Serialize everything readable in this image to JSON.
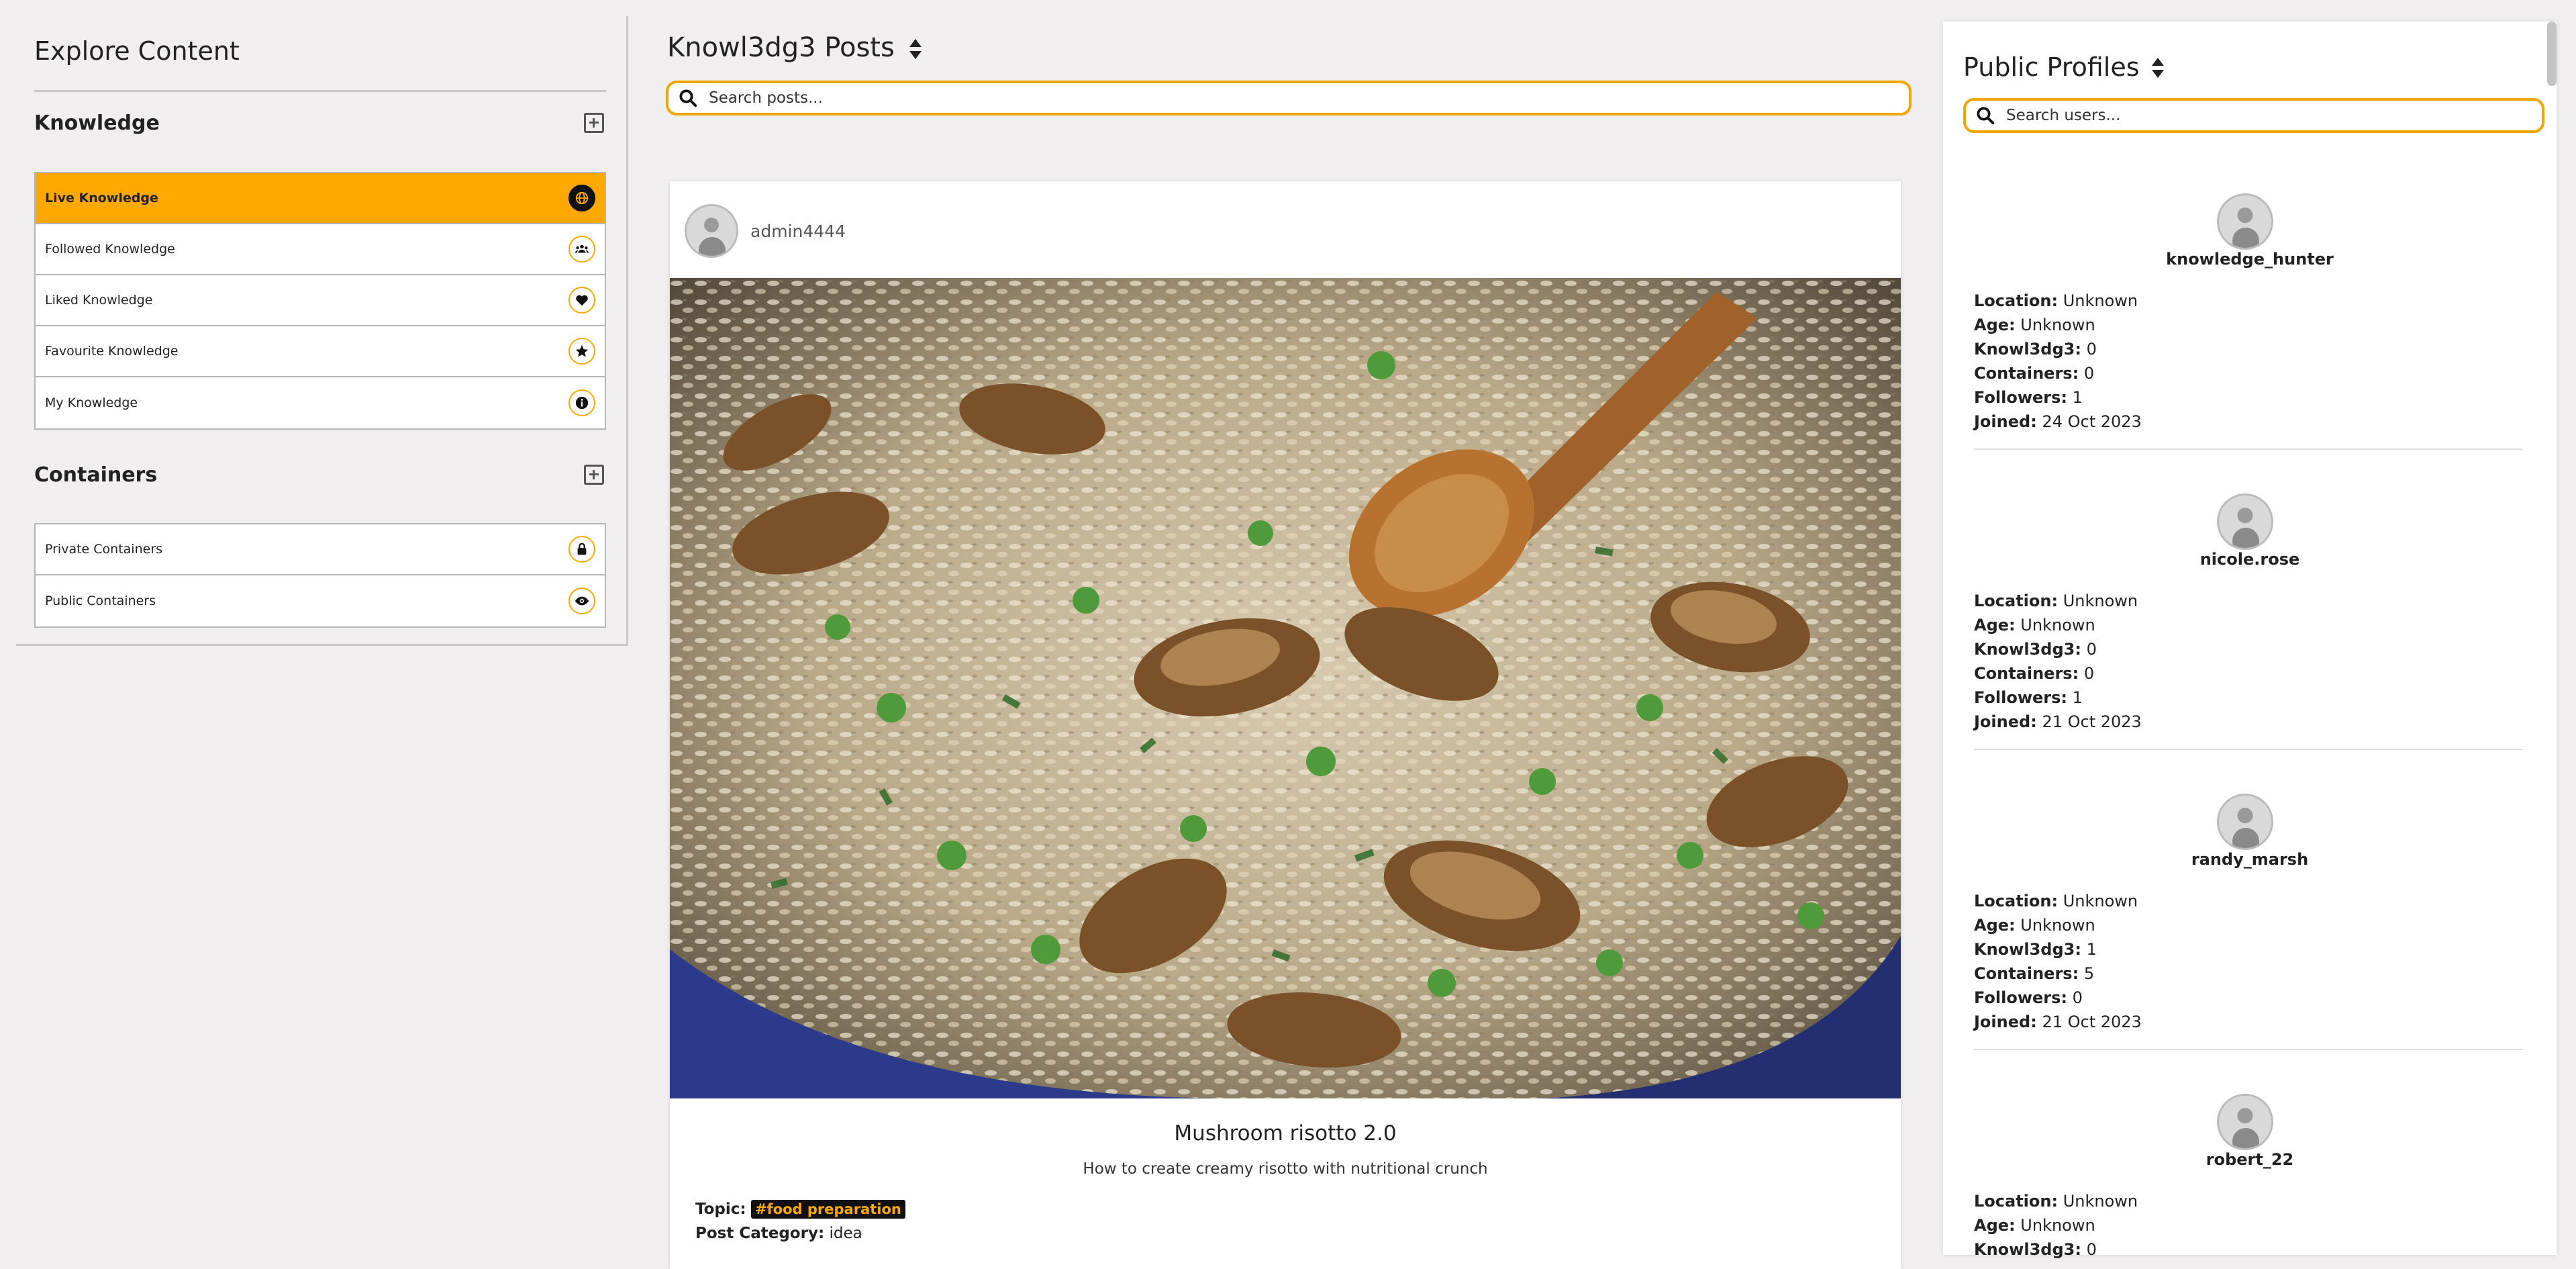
{
  "sidebar": {
    "title": "Explore Content",
    "knowledge_heading": "Knowledge",
    "knowledge_items": [
      {
        "label": "Live Knowledge",
        "icon": "globe-icon"
      },
      {
        "label": "Followed Knowledge",
        "icon": "users-icon"
      },
      {
        "label": "Liked Knowledge",
        "icon": "heart-icon"
      },
      {
        "label": "Favourite Knowledge",
        "icon": "star-icon"
      },
      {
        "label": "My Knowledge",
        "icon": "info-icon"
      }
    ],
    "containers_heading": "Containers",
    "container_items": [
      {
        "label": "Private Containers",
        "icon": "lock-icon"
      },
      {
        "label": "Public Containers",
        "icon": "eye-icon"
      }
    ],
    "accent_color": "#ffa800"
  },
  "posts": {
    "title": "Knowl3dg3 Posts",
    "search_placeholder": "Search posts...",
    "post": {
      "author": "admin4444",
      "title": "Mushroom risotto 2.0",
      "subtitle": "How to create creamy risotto with nutritional crunch",
      "topic_label": "Topic:",
      "topic": "#food preparation",
      "category_label": "Post Category:",
      "category": "idea"
    }
  },
  "profiles": {
    "title": "Public Profiles",
    "search_placeholder": "Search users...",
    "labels": {
      "location": "Location:",
      "age": "Age:",
      "knowledge": "Knowl3dg3:",
      "containers": "Containers:",
      "followers": "Followers:",
      "joined": "Joined:"
    },
    "users": [
      {
        "name": "knowledge_hunter",
        "location": "Unknown",
        "age": "Unknown",
        "knowledge": "0",
        "containers": "0",
        "followers": "1",
        "joined": "24 Oct 2023"
      },
      {
        "name": "nicole.rose",
        "location": "Unknown",
        "age": "Unknown",
        "knowledge": "0",
        "containers": "0",
        "followers": "1",
        "joined": "21 Oct 2023"
      },
      {
        "name": "randy_marsh",
        "location": "Unknown",
        "age": "Unknown",
        "knowledge": "1",
        "containers": "5",
        "followers": "0",
        "joined": "21 Oct 2023"
      },
      {
        "name": "robert_22",
        "location": "Unknown",
        "age": "Unknown",
        "knowledge": "0",
        "containers": "",
        "followers": "",
        "joined": ""
      }
    ]
  }
}
